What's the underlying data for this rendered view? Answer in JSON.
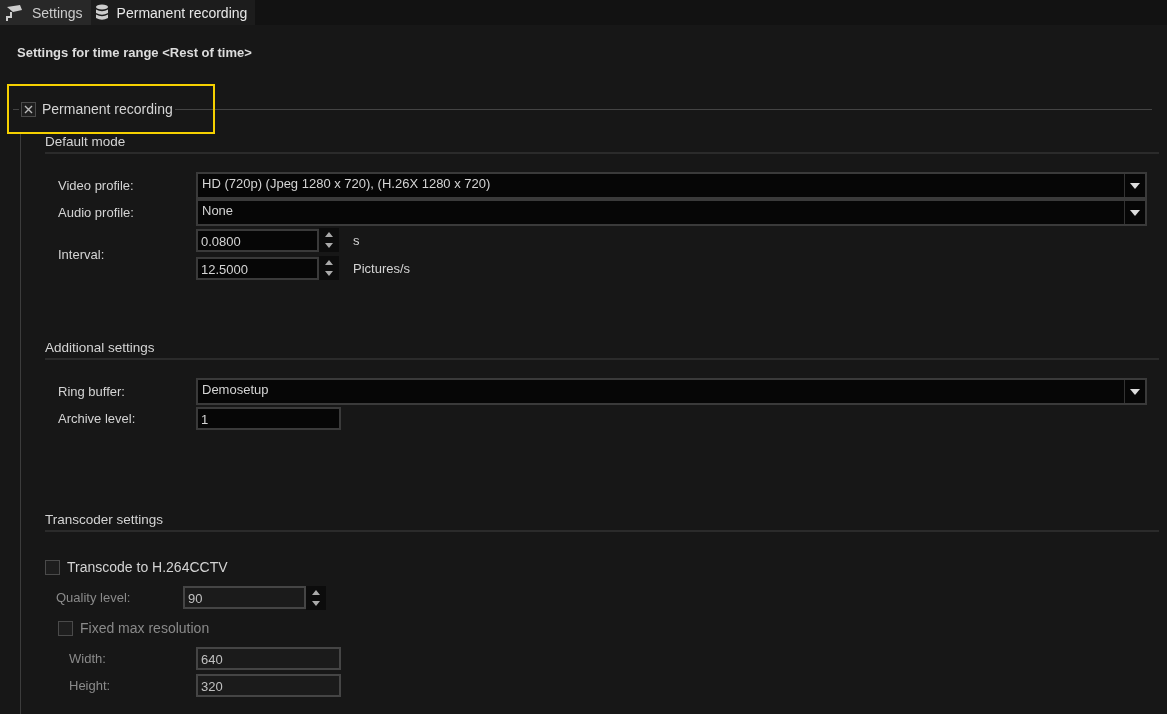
{
  "tabs": [
    {
      "label": "Settings",
      "selected": false
    },
    {
      "label": "Permanent recording",
      "selected": true
    }
  ],
  "heading": "Settings for time range <Rest of time>",
  "group": {
    "label": "Permanent recording",
    "checked": true,
    "highlighted": true,
    "sections": [
      {
        "title": "Default mode",
        "rows": [
          {
            "kind": "dropdown",
            "label": "Video profile:",
            "value": "HD (720p) (Jpeg 1280 x 720),  (H.26X 1280 x 720)"
          },
          {
            "kind": "dropdown",
            "label": "Audio profile:",
            "value": "None"
          },
          {
            "kind": "interval",
            "label": "Interval:",
            "fields": [
              {
                "value": "0.0800",
                "unit": "s"
              },
              {
                "value": "12.5000",
                "unit": "Pictures/s"
              }
            ]
          }
        ]
      },
      {
        "title": "Additional settings",
        "rows": [
          {
            "kind": "dropdown",
            "label": "Ring buffer:",
            "value": "Demosetup"
          },
          {
            "kind": "text",
            "label": "Archive level:",
            "value": "1"
          }
        ]
      },
      {
        "title": "Transcoder settings",
        "rows": [
          {
            "kind": "checkbox",
            "label": "Transcode to H.264CCTV",
            "checked": false,
            "disabled": false,
            "children": [
              {
                "kind": "spin",
                "label": "Quality level:",
                "value": "90",
                "disabled": true
              },
              {
                "kind": "checkbox",
                "label": "Fixed max resolution",
                "checked": false,
                "disabled": true,
                "children": [
                  {
                    "kind": "text",
                    "label": "Width:",
                    "value": "640",
                    "disabled": true
                  },
                  {
                    "kind": "text",
                    "label": "Height:",
                    "value": "320",
                    "disabled": true
                  }
                ]
              }
            ]
          }
        ]
      }
    ]
  }
}
